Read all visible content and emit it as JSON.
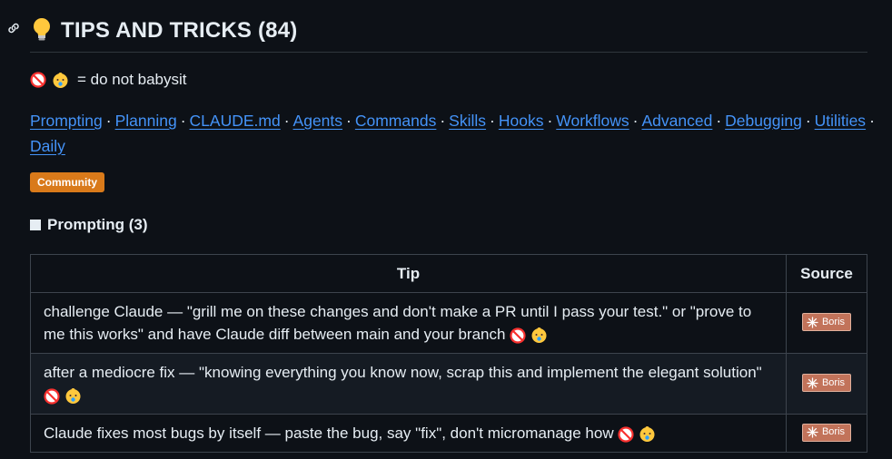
{
  "heading": {
    "title": "TIPS AND TRICKS (84)"
  },
  "legend": {
    "text": "= do not babysit"
  },
  "nav": {
    "links": [
      "Prompting",
      "Planning",
      "CLAUDE.md",
      "Agents",
      "Commands",
      "Skills",
      "Hooks",
      "Workflows",
      "Advanced",
      "Debugging",
      "Utilities",
      "Daily"
    ],
    "separator": "·"
  },
  "badge": {
    "label": "Community"
  },
  "section": {
    "title": "Prompting (3)"
  },
  "table": {
    "headers": [
      "Tip",
      "Source"
    ],
    "rows": [
      {
        "tip": "challenge Claude — \"grill me on these changes and don't make a PR until I pass your test.\" or \"prove to me this works\" and have Claude diff between main and your branch",
        "source": "Boris"
      },
      {
        "tip": "after a mediocre fix — \"knowing everything you know now, scrap this and implement the elegant solution\"",
        "source": "Boris"
      },
      {
        "tip": "Claude fixes most bugs by itself — paste the bug, say \"fix\", don't micromanage how",
        "source": "Boris"
      }
    ]
  },
  "colors": {
    "background": "#0d1117",
    "link": "#4493f8",
    "badge": "#d97a1a",
    "source_badge": "#c2735a"
  }
}
